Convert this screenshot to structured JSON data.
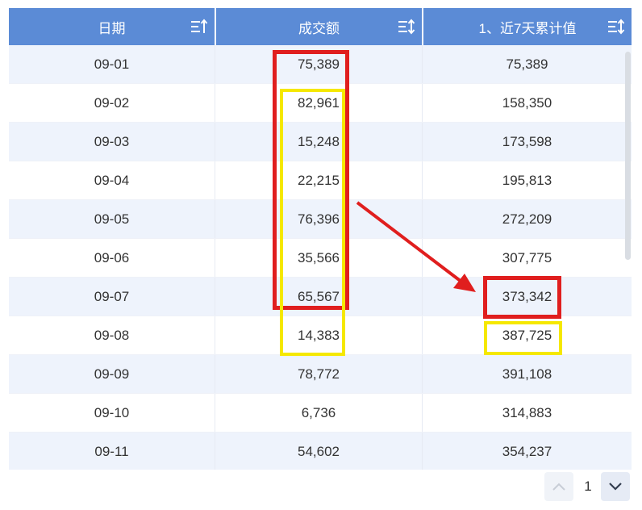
{
  "table": {
    "headers": [
      "日期",
      "成交额",
      "1、近7天累计值"
    ],
    "rows": [
      [
        "09-01",
        "75,389",
        "75,389"
      ],
      [
        "09-02",
        "82,961",
        "158,350"
      ],
      [
        "09-03",
        "15,248",
        "173,598"
      ],
      [
        "09-04",
        "22,215",
        "195,813"
      ],
      [
        "09-05",
        "76,396",
        "272,209"
      ],
      [
        "09-06",
        "35,566",
        "307,775"
      ],
      [
        "09-07",
        "65,567",
        "373,342"
      ],
      [
        "09-08",
        "14,383",
        "387,725"
      ],
      [
        "09-09",
        "78,772",
        "391,108"
      ],
      [
        "09-10",
        "6,736",
        "314,883"
      ],
      [
        "09-11",
        "54,602",
        "354,237"
      ]
    ]
  },
  "pagination": {
    "current_page": "1"
  },
  "colors": {
    "header_bg": "#5b8bd6",
    "row_alt": "#eef3fc",
    "highlight_red": "#e01e1e",
    "highlight_yellow": "#f5e800"
  },
  "icons": [
    "sort-icon",
    "chevron-up-icon",
    "chevron-down-icon",
    "arrow-annotation"
  ]
}
